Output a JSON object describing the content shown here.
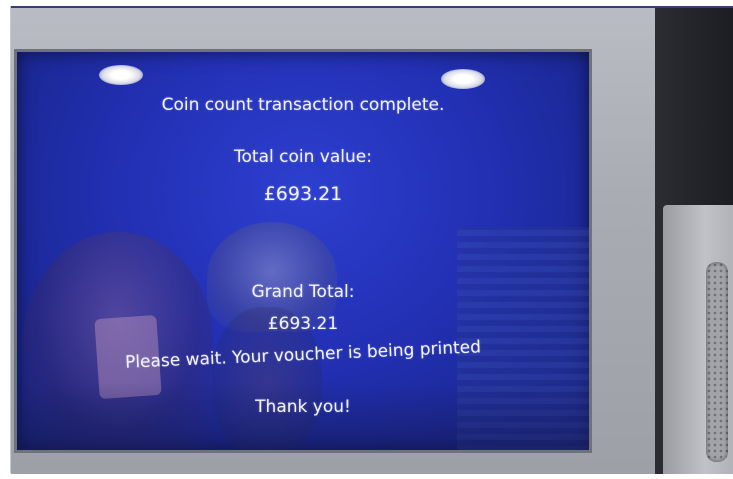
{
  "screen": {
    "status_line": "Coin count transaction complete.",
    "total_label": "Total coin value:",
    "total_value": "£693.21",
    "grand_total_label": "Grand Total:",
    "grand_total_value": "£693.21",
    "wait_message": "Please wait. Your voucher is being printed",
    "thanks_message": "Thank you!"
  },
  "colors": {
    "screen_blue": "#2230b4",
    "text": "#f3f4fb",
    "bezel": "#a9acb3"
  }
}
